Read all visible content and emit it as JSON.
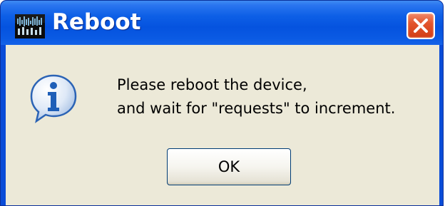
{
  "window": {
    "title": "Reboot",
    "app_icon": "waveform-app-icon",
    "close_icon": "close-x-icon"
  },
  "dialog": {
    "icon": "information-icon",
    "message_lines": [
      "Please reboot the device,",
      "and wait for \"requests\" to increment."
    ],
    "ok_label": "OK"
  },
  "colors": {
    "titlebar": "#0553df",
    "client_background": "#ece9d8",
    "close_button": "#e2542c",
    "info_icon": "#1f5fb8"
  }
}
